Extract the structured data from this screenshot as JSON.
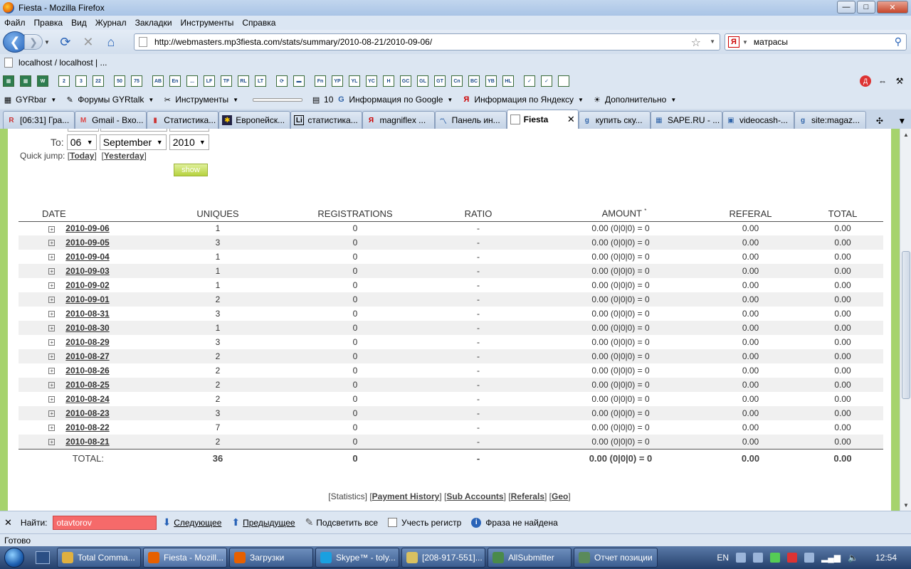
{
  "window": {
    "title": "Fiesta - Mozilla Firefox",
    "min": "—",
    "max": "□",
    "close": "✕"
  },
  "menu": [
    "Файл",
    "Правка",
    "Вид",
    "Журнал",
    "Закладки",
    "Инструменты",
    "Справка"
  ],
  "nav": {
    "url": "http://webmasters.mp3fiesta.com/stats/summary/2010-08-21/2010-09-06/",
    "search_query": "матрасы"
  },
  "bookmark": {
    "label": "localhost / localhost | ..."
  },
  "icon_toolbar": [
    "2",
    "3",
    "22",
    "50",
    "75",
    "AB",
    "En",
    "...",
    "LF",
    "TF",
    "RL",
    "LT",
    "",
    "",
    "Fn",
    "YP",
    "YL",
    "YC",
    "H",
    "GC",
    "GL",
    "GT",
    "Cn",
    "BC",
    "YB",
    "HL"
  ],
  "gyrbar": {
    "items": [
      {
        "label": "GYRbar",
        "icon": "gyr-icon"
      },
      {
        "label": "Форумы GYRtalk",
        "icon": "bulb-icon"
      },
      {
        "label": "Инструменты",
        "icon": "tools-icon"
      }
    ],
    "count": "10",
    "google_info": "Информация по Google",
    "yandex_info": "Информация по Яндексу",
    "extra": "Дополнительно"
  },
  "tabs": [
    {
      "label": "[06:31] Гра...",
      "icon": "tab-icon-r",
      "color": "#c33"
    },
    {
      "label": "Gmail - Вхо...",
      "icon": "gmail-icon",
      "color": "#d44"
    },
    {
      "label": "Статистика...",
      "icon": "chart-icon",
      "color": "#c33"
    },
    {
      "label": "Европейск...",
      "icon": "euro-icon",
      "color": "#224"
    },
    {
      "label": "статистика...",
      "icon": "li-icon",
      "color": "#000"
    },
    {
      "label": "magniflex ...",
      "icon": "yandex-icon",
      "color": "#c00"
    },
    {
      "label": "Панель ин...",
      "icon": "panel-icon",
      "color": "#36a"
    },
    {
      "label": "Fiesta",
      "icon": "page-icon",
      "color": "#888",
      "active": true
    },
    {
      "label": "купить ску...",
      "icon": "google-icon",
      "color": "#36a"
    },
    {
      "label": "SAPE.RU - ...",
      "icon": "sape-icon",
      "color": "#36a"
    },
    {
      "label": "videocash-...",
      "icon": "video-icon",
      "color": "#36a"
    },
    {
      "label": "site:magaz...",
      "icon": "google-icon",
      "color": "#36a"
    }
  ],
  "tab_close": "✕",
  "filter": {
    "to_label": "To:",
    "day": "06",
    "month": "September",
    "year": "2010",
    "quick_jump": "Quick jump:",
    "today": "Today",
    "yesterday": "Yesterday",
    "show": "show"
  },
  "table": {
    "headers": {
      "date": "DATE",
      "uniques": "UNIQUES",
      "registrations": "REGISTRATIONS",
      "ratio": "RATIO",
      "amount": "AMOUNT",
      "amount_mark": "*",
      "referal": "REFERAL",
      "total": "TOTAL"
    },
    "rows": [
      {
        "date": "2010-09-06",
        "uniques": "1",
        "registrations": "0",
        "ratio": "-",
        "amount": "0.00  (0|0|0) = 0",
        "referal": "0.00",
        "total": "0.00"
      },
      {
        "date": "2010-09-05",
        "uniques": "3",
        "registrations": "0",
        "ratio": "-",
        "amount": "0.00  (0|0|0) = 0",
        "referal": "0.00",
        "total": "0.00"
      },
      {
        "date": "2010-09-04",
        "uniques": "1",
        "registrations": "0",
        "ratio": "-",
        "amount": "0.00  (0|0|0) = 0",
        "referal": "0.00",
        "total": "0.00"
      },
      {
        "date": "2010-09-03",
        "uniques": "1",
        "registrations": "0",
        "ratio": "-",
        "amount": "0.00  (0|0|0) = 0",
        "referal": "0.00",
        "total": "0.00"
      },
      {
        "date": "2010-09-02",
        "uniques": "1",
        "registrations": "0",
        "ratio": "-",
        "amount": "0.00  (0|0|0) = 0",
        "referal": "0.00",
        "total": "0.00"
      },
      {
        "date": "2010-09-01",
        "uniques": "2",
        "registrations": "0",
        "ratio": "-",
        "amount": "0.00  (0|0|0) = 0",
        "referal": "0.00",
        "total": "0.00"
      },
      {
        "date": "2010-08-31",
        "uniques": "3",
        "registrations": "0",
        "ratio": "-",
        "amount": "0.00  (0|0|0) = 0",
        "referal": "0.00",
        "total": "0.00"
      },
      {
        "date": "2010-08-30",
        "uniques": "1",
        "registrations": "0",
        "ratio": "-",
        "amount": "0.00  (0|0|0) = 0",
        "referal": "0.00",
        "total": "0.00"
      },
      {
        "date": "2010-08-29",
        "uniques": "3",
        "registrations": "0",
        "ratio": "-",
        "amount": "0.00  (0|0|0) = 0",
        "referal": "0.00",
        "total": "0.00"
      },
      {
        "date": "2010-08-27",
        "uniques": "2",
        "registrations": "0",
        "ratio": "-",
        "amount": "0.00  (0|0|0) = 0",
        "referal": "0.00",
        "total": "0.00"
      },
      {
        "date": "2010-08-26",
        "uniques": "2",
        "registrations": "0",
        "ratio": "-",
        "amount": "0.00  (0|0|0) = 0",
        "referal": "0.00",
        "total": "0.00"
      },
      {
        "date": "2010-08-25",
        "uniques": "2",
        "registrations": "0",
        "ratio": "-",
        "amount": "0.00  (0|0|0) = 0",
        "referal": "0.00",
        "total": "0.00"
      },
      {
        "date": "2010-08-24",
        "uniques": "2",
        "registrations": "0",
        "ratio": "-",
        "amount": "0.00  (0|0|0) = 0",
        "referal": "0.00",
        "total": "0.00"
      },
      {
        "date": "2010-08-23",
        "uniques": "3",
        "registrations": "0",
        "ratio": "-",
        "amount": "0.00  (0|0|0) = 0",
        "referal": "0.00",
        "total": "0.00"
      },
      {
        "date": "2010-08-22",
        "uniques": "7",
        "registrations": "0",
        "ratio": "-",
        "amount": "0.00  (0|0|0) = 0",
        "referal": "0.00",
        "total": "0.00"
      },
      {
        "date": "2010-08-21",
        "uniques": "2",
        "registrations": "0",
        "ratio": "-",
        "amount": "0.00  (0|0|0) = 0",
        "referal": "0.00",
        "total": "0.00"
      }
    ],
    "total": {
      "label": "TOTAL:",
      "uniques": "36",
      "registrations": "0",
      "ratio": "-",
      "amount": "0.00  (0|0|0) = 0",
      "referal": "0.00",
      "total": "0.00"
    }
  },
  "footer_links": {
    "statistics": "[Statistics]",
    "payment": "Payment History",
    "sub": "Sub Accounts",
    "referals": "Referals",
    "geo": "Geo"
  },
  "findbar": {
    "label": "Найти:",
    "value": "otavtorov",
    "next": "Следующее",
    "prev": "Предыдущее",
    "highlight": "Подсветить все",
    "match_case": "Учесть регистр",
    "status": "Фраза не найдена"
  },
  "status": "Готово",
  "taskbar": {
    "items": [
      {
        "label": "Total Comma...",
        "color": "#e0b040"
      },
      {
        "label": "Fiesta - Mozill...",
        "color": "#e66000",
        "active": true
      },
      {
        "label": "Загрузки",
        "color": "#e66000"
      },
      {
        "label": "Skype™ - toly...",
        "color": "#1aa0e0"
      },
      {
        "label": "[208-917-551]...",
        "color": "#d9c060"
      },
      {
        "label": "AllSubmitter",
        "color": "#4a8a4a"
      },
      {
        "label": "Отчет позиции",
        "color": "#5a8a5a"
      }
    ],
    "lang": "EN",
    "clock": "12:54"
  }
}
